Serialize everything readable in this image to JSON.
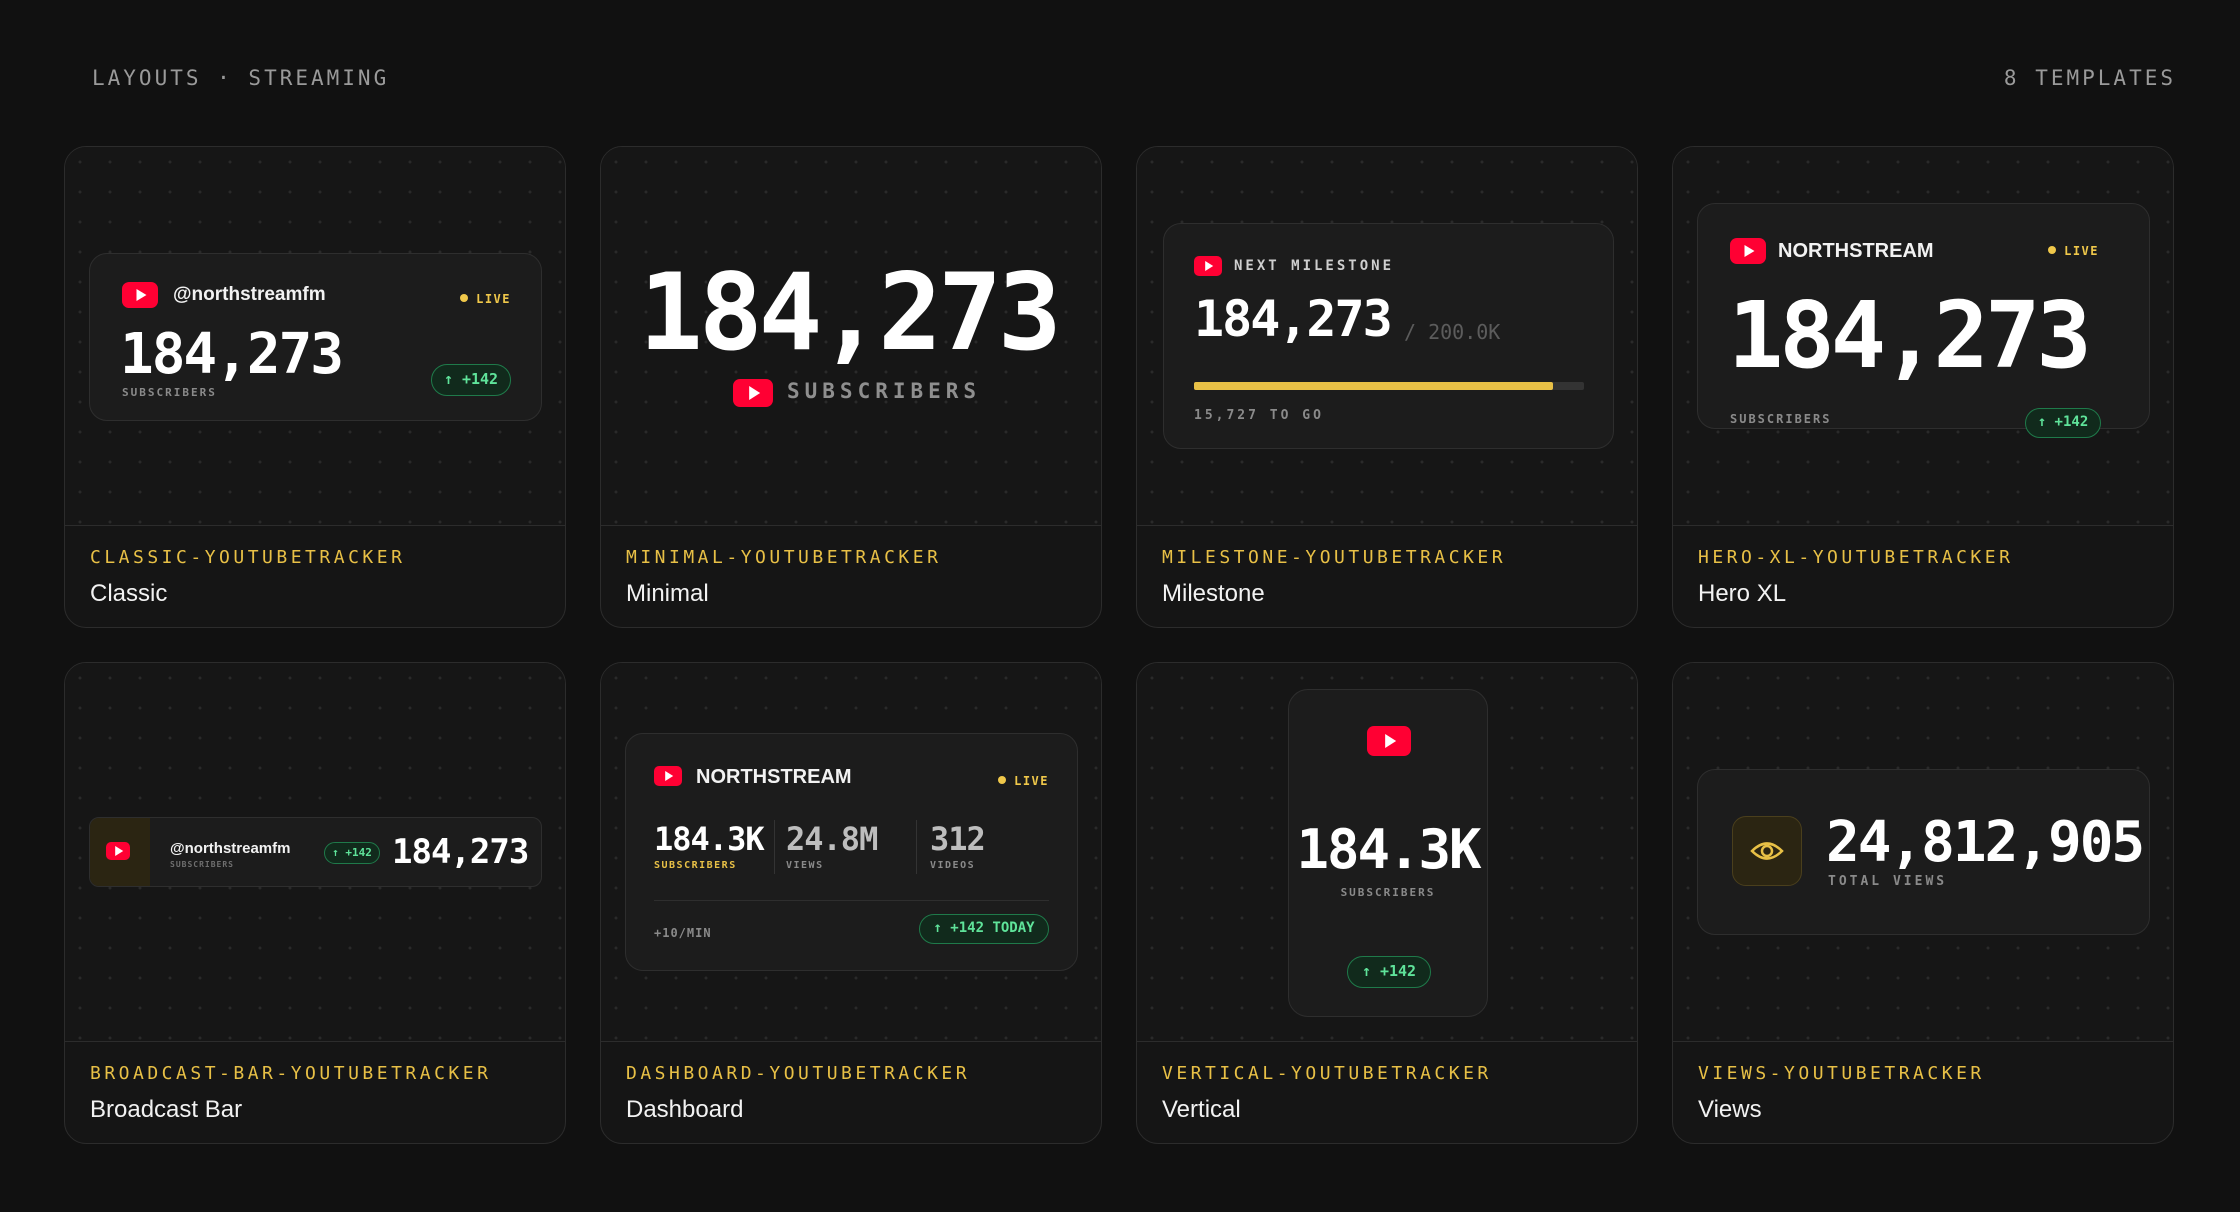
{
  "header": {
    "breadcrumb": "LAYOUTS · STREAMING",
    "template_count": "8 TEMPLATES"
  },
  "colors": {
    "accent": "#e8c046",
    "youtube": "#ff0033",
    "positive": "#5fe39a",
    "background": "#111111"
  },
  "cards": [
    {
      "slug": "CLASSIC-YOUTUBETRACKER",
      "name": "Classic",
      "preview": {
        "icon": "youtube-icon",
        "handle": "@northstreamfm",
        "live": "LIVE",
        "count": "184,273",
        "label": "SUBSCRIBERS",
        "delta": "↑ +142"
      }
    },
    {
      "slug": "MINIMAL-YOUTUBETRACKER",
      "name": "Minimal",
      "preview": {
        "icon": "youtube-icon",
        "count": "184,273",
        "label": "SUBSCRIBERS"
      }
    },
    {
      "slug": "MILESTONE-YOUTUBETRACKER",
      "name": "Milestone",
      "preview": {
        "icon": "youtube-icon",
        "title": "NEXT MILESTONE",
        "count": "184,273",
        "goal": "/ 200.0K",
        "progress": 0.92,
        "remaining": "15,727 TO GO"
      }
    },
    {
      "slug": "HERO-XL-YOUTUBETRACKER",
      "name": "Hero XL",
      "preview": {
        "icon": "youtube-icon",
        "channel": "NORTHSTREAM",
        "live": "LIVE",
        "count": "184,273",
        "label": "SUBSCRIBERS",
        "delta": "↑ +142"
      }
    },
    {
      "slug": "BROADCAST-BAR-YOUTUBETRACKER",
      "name": "Broadcast Bar",
      "preview": {
        "icon": "youtube-icon",
        "handle": "@northstreamfm",
        "label": "SUBSCRIBERS",
        "delta": "↑ +142",
        "count": "184,273"
      }
    },
    {
      "slug": "DASHBOARD-YOUTUBETRACKER",
      "name": "Dashboard",
      "preview": {
        "icon": "youtube-icon",
        "channel": "NORTHSTREAM",
        "live": "LIVE",
        "stats": [
          {
            "value": "184.3K",
            "label": "SUBSCRIBERS"
          },
          {
            "value": "24.8M",
            "label": "VIEWS"
          },
          {
            "value": "312",
            "label": "VIDEOS"
          }
        ],
        "rate": "+10/MIN",
        "delta": "↑ +142 TODAY"
      }
    },
    {
      "slug": "VERTICAL-YOUTUBETRACKER",
      "name": "Vertical",
      "preview": {
        "icon": "youtube-icon",
        "count": "184.3K",
        "label": "SUBSCRIBERS",
        "delta": "↑ +142"
      }
    },
    {
      "slug": "VIEWS-YOUTUBETRACKER",
      "name": "Views",
      "preview": {
        "icon": "eye-icon",
        "count": "24,812,905",
        "label": "TOTAL VIEWS"
      }
    }
  ]
}
